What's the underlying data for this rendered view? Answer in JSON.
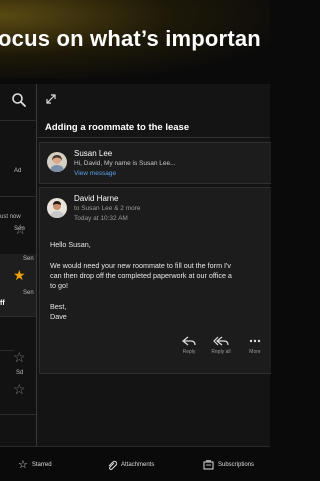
{
  "banner": {
    "text": "ocus on what’s importan"
  },
  "message_list": {
    "items": [
      {
        "date": "Ad",
        "starred": false
      },
      {
        "line1": "ust now",
        "line2": "Sen",
        "starred": false
      },
      {
        "date": "Sen",
        "flag": "ff",
        "starred": true
      },
      {
        "date": "Sen",
        "flag": "ff",
        "starred": false
      },
      {
        "date": "Sd",
        "starred": false
      }
    ]
  },
  "reading_pane": {
    "thread_title": "Adding a roommate to the lease",
    "messages": [
      {
        "sender": "Susan Lee",
        "preview": "Hi, David, My name is Susan Lee...",
        "view_message": "View message"
      },
      {
        "sender": "David Harne",
        "to": "to Susan Lee & 2 more",
        "time": "Today at 10:32 AM",
        "body": {
          "greeting": "Hello Susan,",
          "line1": "We would need your new roommate to fill out the form I'v",
          "line2": "can then drop off the completed paperwork at our office a",
          "line3": "to go!",
          "signoff": "Best,",
          "name": "Dave"
        },
        "actions": {
          "reply": "Reply",
          "reply_all": "Reply all",
          "more": "More"
        }
      }
    ]
  },
  "bottom_tabs": [
    {
      "label": "Starred",
      "icon": "star-icon"
    },
    {
      "label": "Attachments",
      "icon": "paperclip-icon"
    },
    {
      "label": "Subscriptions",
      "icon": "subscriptions-icon"
    }
  ],
  "colors": {
    "accent_star": "#f0a30a",
    "link": "#5aa0e8",
    "background": "#0a0a0a"
  }
}
